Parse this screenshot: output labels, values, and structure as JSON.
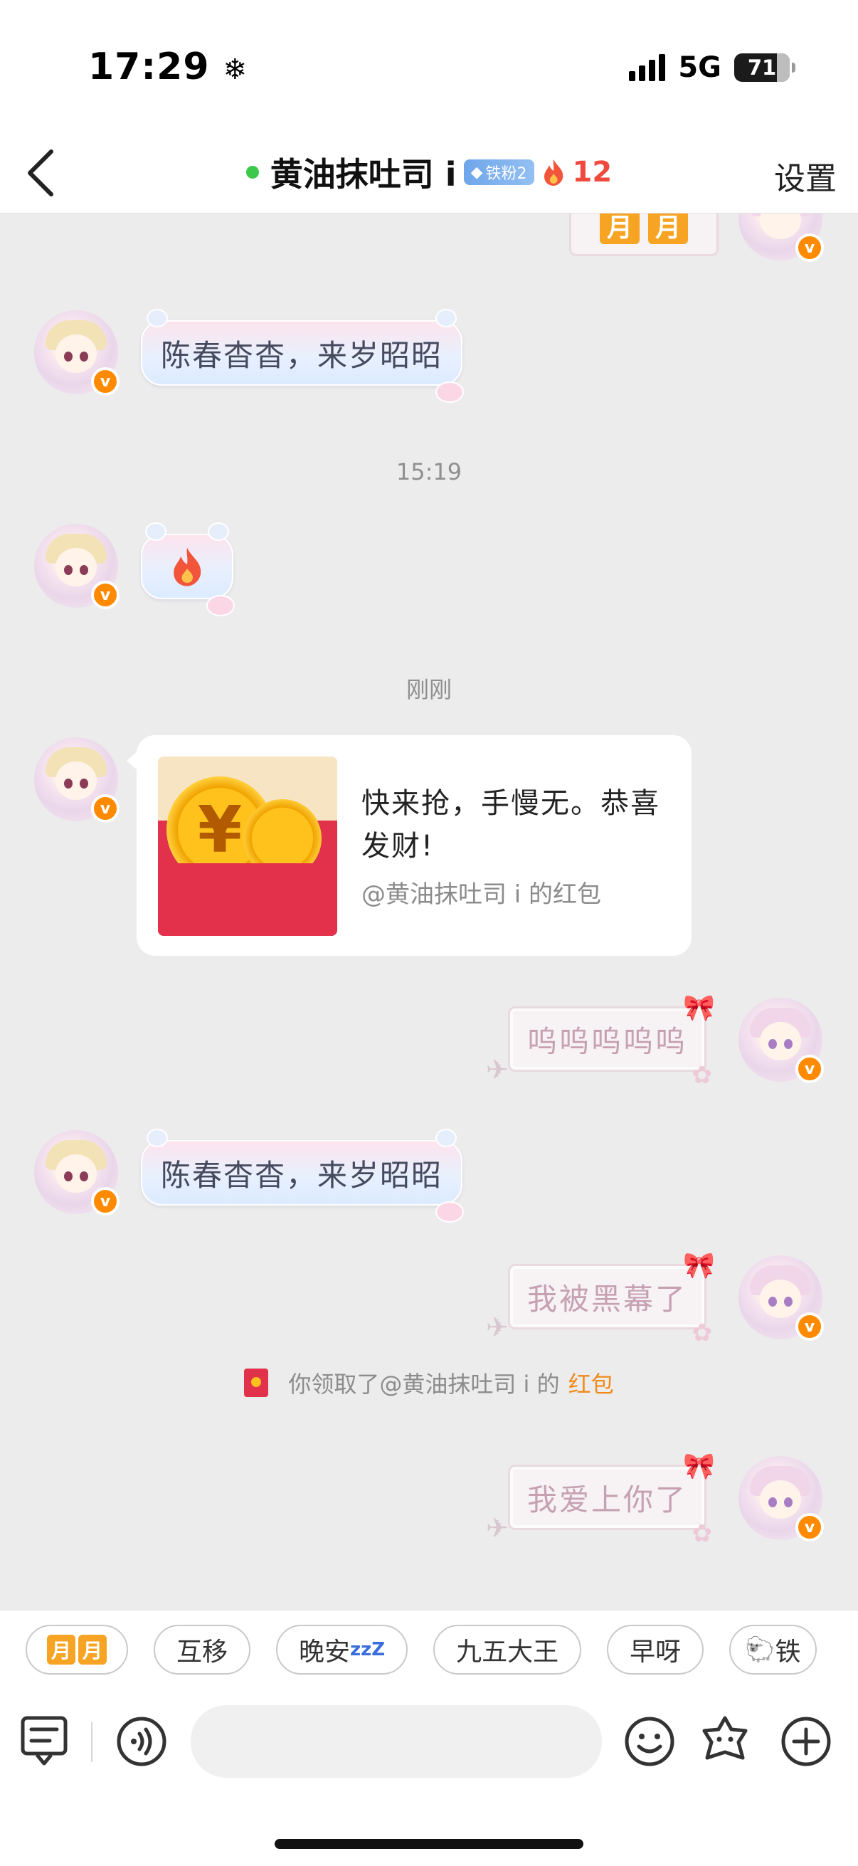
{
  "status_bar": {
    "time": "17:29",
    "time_icon": "snowflake-icon",
    "network": "5G",
    "battery": "71"
  },
  "nav": {
    "back_icon": "chevron-left-icon",
    "title": "黄油抹吐司 i",
    "fan_badge": "铁粉2",
    "fire_count": "12",
    "settings": "设置"
  },
  "messages": {
    "top_moon": "月",
    "msg1": "陈春杳杳，来岁昭昭",
    "time1": "15:19",
    "msg2_icon": "fire-emoji-icon",
    "time2": "刚刚",
    "packet": {
      "title": "快来抢，手慢无。恭喜发财!",
      "from": "@黄油抹吐司 i 的红包"
    },
    "msg3": "呜呜呜呜呜",
    "msg4": "陈春杳杳，来岁昭昭",
    "msg5": "我被黑幕了",
    "notice_prefix": "你领取了@黄油抹吐司 i 的",
    "notice_link": "红包",
    "msg6": "我爱上你了"
  },
  "chips": {
    "moon": "月",
    "c2": "互移",
    "c3": "晚安",
    "c3_zzz": "zzZ",
    "c4": "九五大王",
    "c5": "早呀",
    "c6": "铁",
    "c6_icon": "sheep-emoji-icon"
  },
  "colors": {
    "accent": "#f08a1c",
    "fire": "#f04a3e",
    "packet_red": "#e2314a",
    "online": "#3cc84a"
  }
}
